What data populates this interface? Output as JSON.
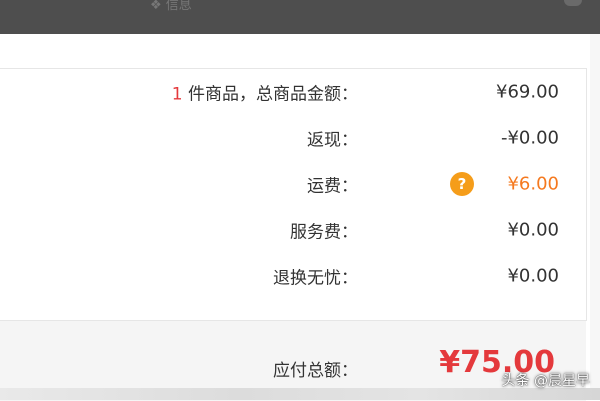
{
  "topbar": {
    "faint_text": "❖ 信息"
  },
  "summary": {
    "rows": [
      {
        "qty": "1",
        "label_suffix": " 件商品，总商品金额：",
        "value": "¥69.00"
      },
      {
        "label": "返现：",
        "value": "-¥0.00"
      },
      {
        "label": "运费：",
        "value": "¥6.00",
        "help_icon": "?"
      },
      {
        "label": "服务费：",
        "value": "¥0.00"
      },
      {
        "label": "退换无忧：",
        "value": "¥0.00"
      }
    ]
  },
  "total": {
    "label": "应付总额：",
    "value": "¥75.00"
  },
  "watermark": "头条 @晨星早",
  "colors": {
    "accent_red": "#e4393c",
    "shipping_orange": "#f5791f",
    "help_icon_bg": "#f59d1a",
    "topbar_bg": "#4e4e4e"
  }
}
